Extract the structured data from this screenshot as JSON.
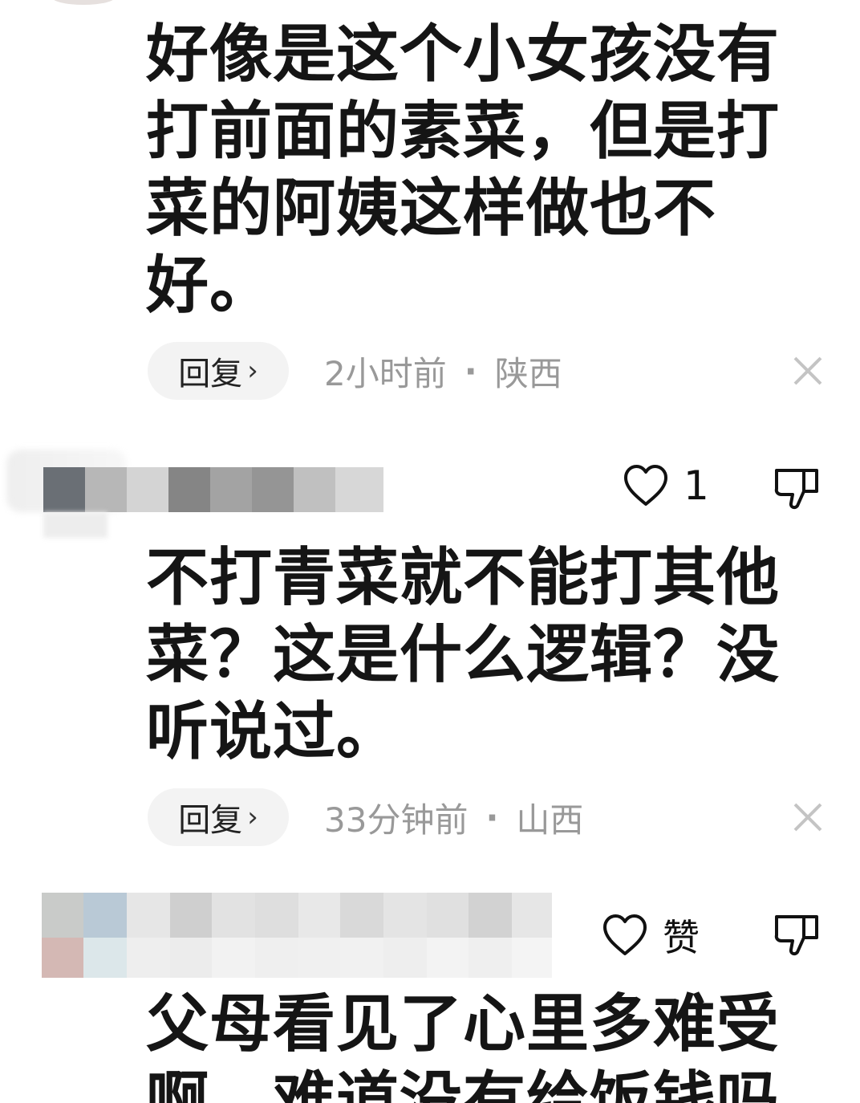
{
  "comments": [
    {
      "text": "好像是这个小女孩没有打前面的素菜，但是打菜的阿姨这样做也不好。",
      "reply_label": "回复",
      "time": "2小时前",
      "location": "陕西"
    },
    {
      "like_count": "1",
      "text": "不打青菜就不能打其他菜？这是什么逻辑？没听说过。",
      "reply_label": "回复",
      "time": "33分钟前",
      "location": "山西"
    },
    {
      "like_label": "赞",
      "text": "父母看见了心里多难受啊，难道没有给饭钱吗"
    }
  ],
  "separator": "·",
  "icons": {
    "like": "heart-outline-icon",
    "dislike": "thumbs-down-outline-icon",
    "close": "close-x-icon",
    "reply_chevron": "chevron-right-icon"
  },
  "colors": {
    "text": "#151515",
    "meta": "#999999",
    "pill_bg": "#f3f3f3"
  }
}
